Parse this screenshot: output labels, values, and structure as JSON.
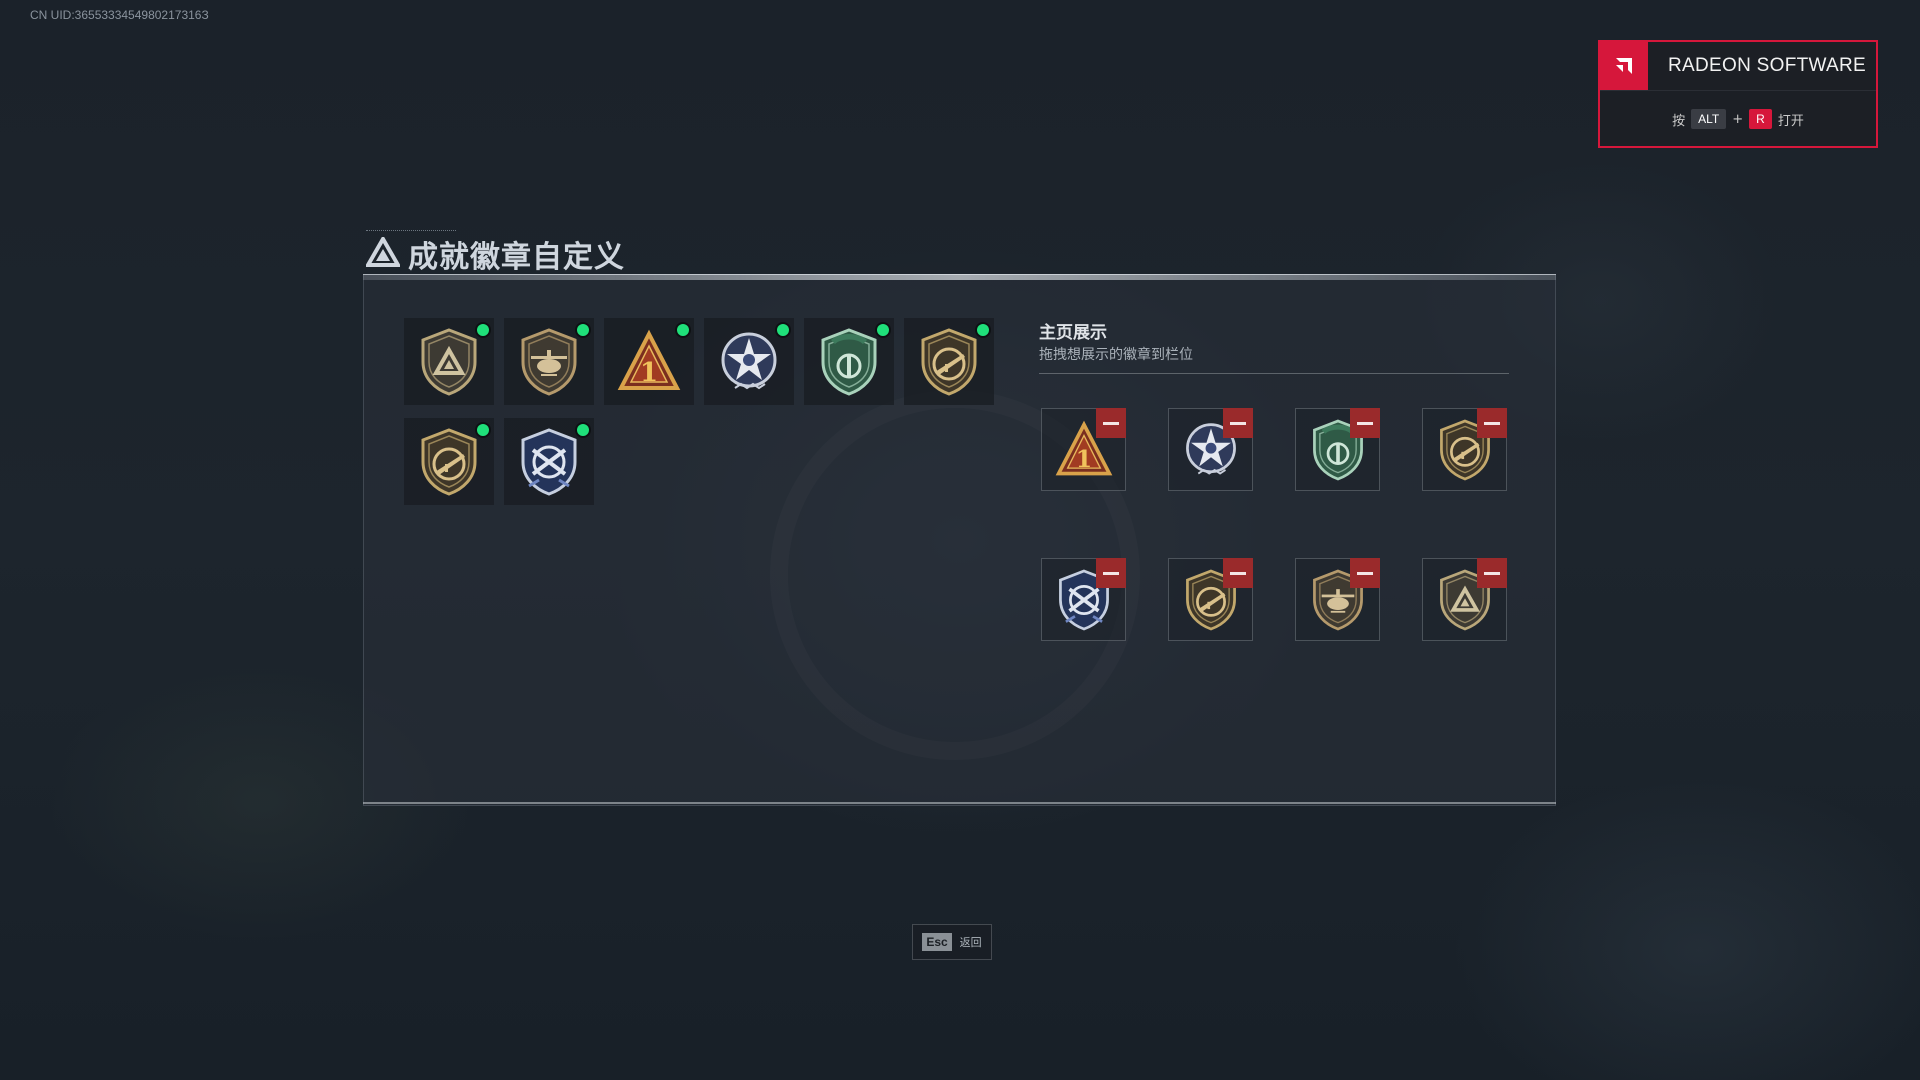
{
  "uid": "CN UID:3655333454980217316З",
  "radeon": {
    "title": "RADEON SOFTWARE",
    "press": "按",
    "key1": "ALT",
    "plus": "+",
    "key2": "R",
    "open": "打开",
    "accent": "#d6173b"
  },
  "panel": {
    "title": "成就徽章自定义",
    "inventory": [
      {
        "icon": "shield-triangle-badge",
        "equipped": true
      },
      {
        "icon": "helicopter-badge",
        "equipped": true
      },
      {
        "icon": "number-one-triangle-badge",
        "equipped": true
      },
      {
        "icon": "star-wings-badge",
        "equipped": true
      },
      {
        "icon": "green-shield-badge",
        "equipped": true
      },
      {
        "icon": "rifle-shield-badge",
        "equipped": true
      },
      {
        "icon": "rifle-shield-badge",
        "equipped": true
      },
      {
        "icon": "blue-crest-badge",
        "equipped": true
      }
    ],
    "showcase": {
      "title": "主页展示",
      "subtitle": "拖拽想展示的徽章到栏位",
      "slots": [
        {
          "icon": "number-one-triangle-badge"
        },
        {
          "icon": "star-wings-badge"
        },
        {
          "icon": "green-shield-badge"
        },
        {
          "icon": "rifle-shield-badge"
        },
        {
          "icon": "blue-crest-badge"
        },
        {
          "icon": "rifle-shield-badge"
        },
        {
          "icon": "helicopter-badge"
        },
        {
          "icon": "shield-triangle-badge"
        }
      ]
    }
  },
  "footer": {
    "esc_key": "Esc",
    "esc_label": "返回"
  }
}
